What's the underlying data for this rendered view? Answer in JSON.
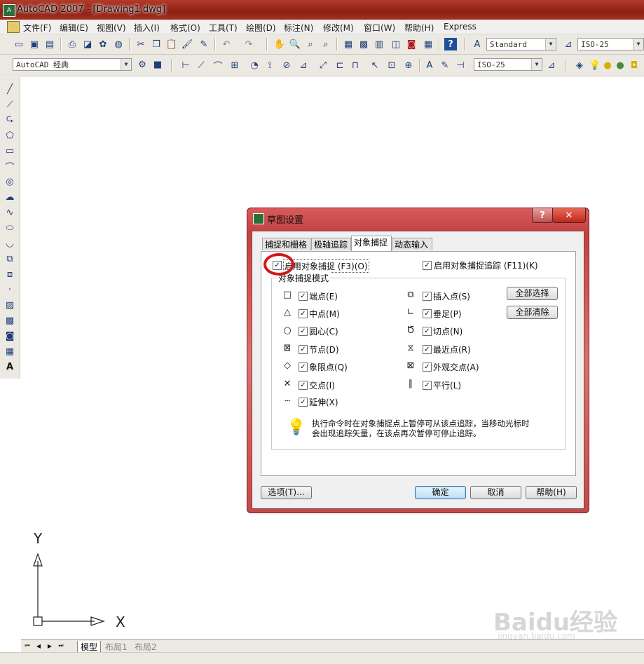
{
  "window": {
    "title": "AutoCAD 2007 - [Drawing1.dwg]"
  },
  "menu": [
    "文件(F)",
    "编辑(E)",
    "视图(V)",
    "插入(I)",
    "格式(O)",
    "工具(T)",
    "绘图(D)",
    "标注(N)",
    "修改(M)",
    "窗口(W)",
    "帮助(H)",
    "Express"
  ],
  "toolbar": {
    "text_style": "Standard",
    "dim_style": "ISO-25",
    "workspace": "AutoCAD 经典",
    "dim_style2": "ISO-25"
  },
  "dialog": {
    "title": "草图设置",
    "help_btn": "?",
    "close_btn": "✕",
    "tabs": [
      "捕捉和栅格",
      "极轴追踪",
      "对象捕捉",
      "动态输入"
    ],
    "active_tab": "对象捕捉",
    "enable_osnap": "启用对象捕捉 (F3)(O)",
    "enable_tracking": "启用对象捕捉追踪 (F11)(K)",
    "group_label": "对象捕捉模式",
    "left_modes": [
      {
        "symbol": "□",
        "label": "端点(E)"
      },
      {
        "symbol": "△",
        "label": "中点(M)"
      },
      {
        "symbol": "○",
        "label": "圆心(C)"
      },
      {
        "symbol": "⊠",
        "label": "节点(D)"
      },
      {
        "symbol": "◇",
        "label": "象限点(Q)"
      },
      {
        "symbol": "✕",
        "label": "交点(I)"
      },
      {
        "symbol": "┄",
        "label": "延伸(X)"
      }
    ],
    "right_modes": [
      {
        "symbol": "⧉",
        "label": "插入点(S)"
      },
      {
        "symbol": "∟",
        "label": "垂足(P)"
      },
      {
        "symbol": "Ծ",
        "label": "切点(N)"
      },
      {
        "symbol": "⧖",
        "label": "最近点(R)"
      },
      {
        "symbol": "⊠",
        "label": "外观交点(A)"
      },
      {
        "symbol": "∥",
        "label": "平行(L)"
      }
    ],
    "select_all": "全部选择",
    "clear_all": "全部清除",
    "hint_line1": "执行命令时在对象捕捉点上暂停可从该点追踪，当移动光标时",
    "hint_line2": "会出现追踪矢量，在该点再次暂停可停止追踪。",
    "options_btn": "选项(T)...",
    "ok_btn": "确定",
    "cancel_btn": "取消",
    "help_button": "帮助(H)"
  },
  "ucs": {
    "x": "X",
    "y": "Y"
  },
  "layout_tabs": [
    "模型",
    "布局1",
    "布局2"
  ],
  "watermark": {
    "text": "Baidu经验",
    "sub": "jingyan.baidu.com"
  },
  "colors": {
    "title_bar": "#a4321f",
    "dialog_frame": "#d05050",
    "highlight_circle": "#d01818"
  }
}
